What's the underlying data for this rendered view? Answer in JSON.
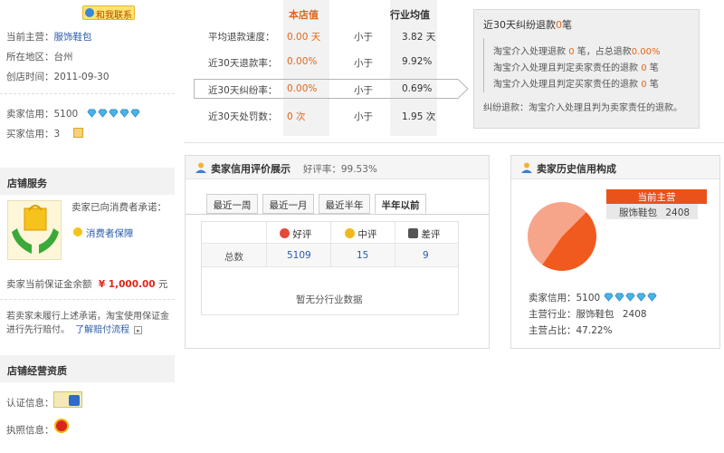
{
  "left": {
    "contact_label": "和我联系",
    "main_business_label": "当前主营：",
    "main_business_value": "服饰鞋包",
    "region_label": "所在地区：",
    "region_value": "台州",
    "created_label": "创店时间：",
    "created_value": "2011-09-30",
    "seller_credit_label": "卖家信用：",
    "seller_credit_value": "5100",
    "buyer_credit_label": "买家信用：",
    "buyer_credit_value": "3",
    "store_service_title": "店铺服务",
    "promise_text": "卖家已向消费者承诺：",
    "consumer_protection_link": "消费者保障",
    "deposit_label": "卖家当前保证金余额",
    "deposit_value": "¥ 1,000.00",
    "deposit_unit": "元",
    "note_line1": "若卖家未履行上述承诺，淘宝使用保证金",
    "note_line2": "进行先行赔付。",
    "payout_link": "了解赔付流程",
    "qualification_title": "店铺经营资质",
    "cert_label": "认证信息：",
    "license_label": "执照信息："
  },
  "stats": {
    "header_store": "本店值",
    "header_industry": "行业均值",
    "rows": [
      {
        "label": "平均退款速度：",
        "value": "0.00 天",
        "compare": "小于",
        "avg": "3.82 天"
      },
      {
        "label": "近30天退款率：",
        "value": "0.00%",
        "compare": "小于",
        "avg": "9.92%"
      },
      {
        "label": "近30天纠纷率：",
        "value": "0.00%",
        "compare": "小于",
        "avg": "0.69%"
      },
      {
        "label": "近30天处罚数：",
        "value": "0 次",
        "compare": "小于",
        "avg": "1.95 次"
      }
    ]
  },
  "dispute": {
    "title_prefix": "近30天纠纷退款",
    "title_count": "0",
    "title_suffix": "笔",
    "line1_a": "淘宝介入处理退款",
    "line1_count": "0",
    "line1_b": "笔，占总退款",
    "line1_pct": "0.00%",
    "line2_a": "淘宝介入处理且判定卖家责任的退款",
    "line2_count": "0",
    "line2_b": "笔",
    "line3_a": "淘宝介入处理且判定买家责任的退款",
    "line3_count": "0",
    "line3_b": "笔",
    "note": "纠纷退款：淘宝介入处理且判为卖家责任的退款。"
  },
  "rating_panel": {
    "title": "卖家信用评价展示",
    "rate_label": "好评率：",
    "rate_value": "99.53%",
    "tabs": [
      "最近一周",
      "最近一月",
      "最近半年",
      "半年以前"
    ],
    "active_tab": 3,
    "col_good": "好评",
    "col_mid": "中评",
    "col_bad": "差评",
    "row_label": "总数",
    "good": "5109",
    "mid": "15",
    "bad": "9",
    "empty_text": "暂无分行业数据"
  },
  "history_panel": {
    "title": "卖家历史信用构成",
    "tag_current": "当前主营",
    "tag_category": "服饰鞋包",
    "tag_value": "2408",
    "pie_share": 0.4722,
    "credit_label": "卖家信用：",
    "credit_value": "5100",
    "industry_label": "主营行业：",
    "industry_value": "服饰鞋包",
    "industry_count": "2408",
    "ratio_label": "主营占比：",
    "ratio_value": "47.22%",
    "colors": {
      "main": "#f05a1e",
      "rest": "#f6a58a"
    }
  }
}
